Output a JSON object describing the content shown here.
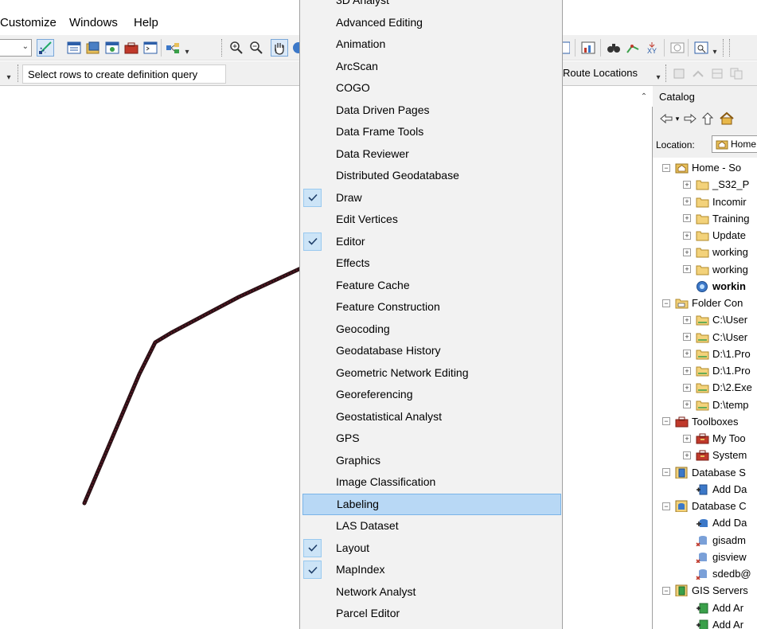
{
  "menubar": {
    "items": [
      "Customize",
      "Windows",
      "Help"
    ]
  },
  "toolbar2": {
    "definition_query_text": "Select rows to create definition query",
    "route_locations_label": "Route Locations"
  },
  "catalog": {
    "title": "Catalog",
    "location_label": "Location:",
    "location_value": "Home",
    "tree": [
      {
        "label": "Home - So",
        "level": 0,
        "expander": "minus",
        "icon": "home-folder-icon",
        "bold": false
      },
      {
        "label": "_S32_P",
        "level": 1,
        "expander": "plus",
        "icon": "folder-icon",
        "bold": false
      },
      {
        "label": "Incomir",
        "level": 1,
        "expander": "plus",
        "icon": "folder-icon",
        "bold": false
      },
      {
        "label": "Training",
        "level": 1,
        "expander": "plus",
        "icon": "folder-icon",
        "bold": false
      },
      {
        "label": "Update",
        "level": 1,
        "expander": "plus",
        "icon": "folder-icon",
        "bold": false
      },
      {
        "label": "working",
        "level": 1,
        "expander": "plus",
        "icon": "folder-icon",
        "bold": false
      },
      {
        "label": "working",
        "level": 1,
        "expander": "plus",
        "icon": "folder-icon",
        "bold": false
      },
      {
        "label": "workin",
        "level": 1,
        "expander": "none",
        "icon": "geodatabase-icon",
        "bold": true
      },
      {
        "label": "Folder Con",
        "level": 0,
        "expander": "minus",
        "icon": "folder-connections-icon",
        "bold": false
      },
      {
        "label": "C:\\User",
        "level": 1,
        "expander": "plus",
        "icon": "folder-connection-icon",
        "bold": false
      },
      {
        "label": "C:\\User",
        "level": 1,
        "expander": "plus",
        "icon": "folder-connection-icon",
        "bold": false
      },
      {
        "label": "D:\\1.Pro",
        "level": 1,
        "expander": "plus",
        "icon": "folder-connection-icon",
        "bold": false
      },
      {
        "label": "D:\\1.Pro",
        "level": 1,
        "expander": "plus",
        "icon": "folder-connection-icon",
        "bold": false
      },
      {
        "label": "D:\\2.Exe",
        "level": 1,
        "expander": "plus",
        "icon": "folder-connection-icon",
        "bold": false
      },
      {
        "label": "D:\\temp",
        "level": 1,
        "expander": "plus",
        "icon": "folder-connection-icon",
        "bold": false
      },
      {
        "label": "Toolboxes",
        "level": 0,
        "expander": "minus",
        "icon": "toolboxes-icon",
        "bold": false
      },
      {
        "label": "My Too",
        "level": 1,
        "expander": "plus",
        "icon": "toolbox-icon",
        "bold": false
      },
      {
        "label": "System",
        "level": 1,
        "expander": "plus",
        "icon": "toolbox-icon",
        "bold": false
      },
      {
        "label": "Database S",
        "level": 0,
        "expander": "minus",
        "icon": "database-servers-icon",
        "bold": false
      },
      {
        "label": "Add Da",
        "level": 1,
        "expander": "none",
        "icon": "add-database-server-icon",
        "bold": false
      },
      {
        "label": "Database C",
        "level": 0,
        "expander": "minus",
        "icon": "database-connections-icon",
        "bold": false
      },
      {
        "label": "Add Da",
        "level": 1,
        "expander": "none",
        "icon": "add-database-connection-icon",
        "bold": false
      },
      {
        "label": "gisadm",
        "level": 1,
        "expander": "none",
        "icon": "sde-connection-icon",
        "bold": false
      },
      {
        "label": "gisview",
        "level": 1,
        "expander": "none",
        "icon": "sde-connection-icon",
        "bold": false
      },
      {
        "label": "sdedb@",
        "level": 1,
        "expander": "none",
        "icon": "sde-connection-icon",
        "bold": false
      },
      {
        "label": "GIS Servers",
        "level": 0,
        "expander": "minus",
        "icon": "gis-servers-icon",
        "bold": false
      },
      {
        "label": "Add Ar",
        "level": 1,
        "expander": "none",
        "icon": "add-arcgis-server-icon",
        "bold": false
      },
      {
        "label": "Add Ar",
        "level": 1,
        "expander": "none",
        "icon": "add-arcgis-server-icon",
        "bold": false
      }
    ]
  },
  "dropdown": {
    "items": [
      {
        "label": "3D Analyst",
        "checked": false,
        "highlighted": false
      },
      {
        "label": "Advanced Editing",
        "checked": false,
        "highlighted": false
      },
      {
        "label": "Animation",
        "checked": false,
        "highlighted": false
      },
      {
        "label": "ArcScan",
        "checked": false,
        "highlighted": false
      },
      {
        "label": "COGO",
        "checked": false,
        "highlighted": false
      },
      {
        "label": "Data Driven Pages",
        "checked": false,
        "highlighted": false
      },
      {
        "label": "Data Frame Tools",
        "checked": false,
        "highlighted": false
      },
      {
        "label": "Data Reviewer",
        "checked": false,
        "highlighted": false
      },
      {
        "label": "Distributed Geodatabase",
        "checked": false,
        "highlighted": false
      },
      {
        "label": "Draw",
        "checked": true,
        "highlighted": false
      },
      {
        "label": "Edit Vertices",
        "checked": false,
        "highlighted": false
      },
      {
        "label": "Editor",
        "checked": true,
        "highlighted": false
      },
      {
        "label": "Effects",
        "checked": false,
        "highlighted": false
      },
      {
        "label": "Feature Cache",
        "checked": false,
        "highlighted": false
      },
      {
        "label": "Feature Construction",
        "checked": false,
        "highlighted": false
      },
      {
        "label": "Geocoding",
        "checked": false,
        "highlighted": false
      },
      {
        "label": "Geodatabase History",
        "checked": false,
        "highlighted": false
      },
      {
        "label": "Geometric Network Editing",
        "checked": false,
        "highlighted": false
      },
      {
        "label": "Georeferencing",
        "checked": false,
        "highlighted": false
      },
      {
        "label": "Geostatistical Analyst",
        "checked": false,
        "highlighted": false
      },
      {
        "label": "GPS",
        "checked": false,
        "highlighted": false
      },
      {
        "label": "Graphics",
        "checked": false,
        "highlighted": false
      },
      {
        "label": "Image Classification",
        "checked": false,
        "highlighted": false
      },
      {
        "label": "Labeling",
        "checked": false,
        "highlighted": true
      },
      {
        "label": "LAS Dataset",
        "checked": false,
        "highlighted": false
      },
      {
        "label": "Layout",
        "checked": true,
        "highlighted": false
      },
      {
        "label": "MapIndex",
        "checked": true,
        "highlighted": false
      },
      {
        "label": "Network Analyst",
        "checked": false,
        "highlighted": false
      },
      {
        "label": "Parcel Editor",
        "checked": false,
        "highlighted": false
      }
    ]
  },
  "colors": {
    "menu_background": "#f2f2f2",
    "highlight_fill": "#b8d8f5",
    "highlight_border": "#7ab4e8",
    "check_fill": "#cce4f7",
    "map_line": "#5a1020"
  }
}
